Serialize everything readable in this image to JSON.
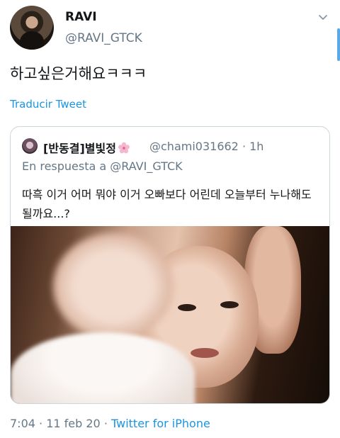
{
  "author": {
    "display_name": "RAVI",
    "handle": "@RAVI_GTCK"
  },
  "tweet": {
    "text": "하고싶은거해요ㅋㅋㅋ",
    "translate_label": "Traducir Tweet"
  },
  "quoted": {
    "display_name": "[반동결]별빛정",
    "handle_time": "@chami031662 · 1h",
    "reply_to": "En respuesta a @RAVI_GTCK",
    "text": "따흑 이거 어머 뭐야 이거 오빠보다 어린데 오늘부터 누나해도 될까요...?"
  },
  "footer": {
    "time": "7:04",
    "sep1": " · ",
    "date": "11 feb 20",
    "sep2": " · ",
    "source": "Twitter for iPhone"
  },
  "colors": {
    "link": "#1b95e0",
    "muted": "#657786",
    "text": "#14171a",
    "border": "#ccd6dd"
  },
  "icons": {
    "menu": "chevron-down-icon",
    "flower": "cherry-blossom-icon"
  }
}
